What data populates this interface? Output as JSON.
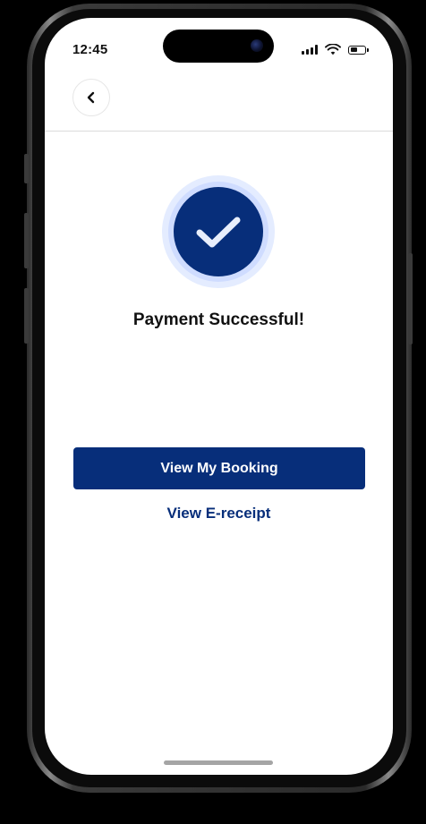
{
  "status_bar": {
    "time": "12:45",
    "icons": [
      "cellular-signal-icon",
      "wifi-icon",
      "battery-icon"
    ],
    "battery_level": 0.5
  },
  "header": {
    "back_icon": "chevron-left-icon"
  },
  "success": {
    "icon": "checkmark-icon",
    "title": "Payment Successful!"
  },
  "actions": {
    "primary_label": "View My Booking",
    "secondary_label": "View E-receipt"
  },
  "colors": {
    "brand": "#072e7a",
    "halo": "#e4ecff",
    "background": "#ffffff"
  }
}
